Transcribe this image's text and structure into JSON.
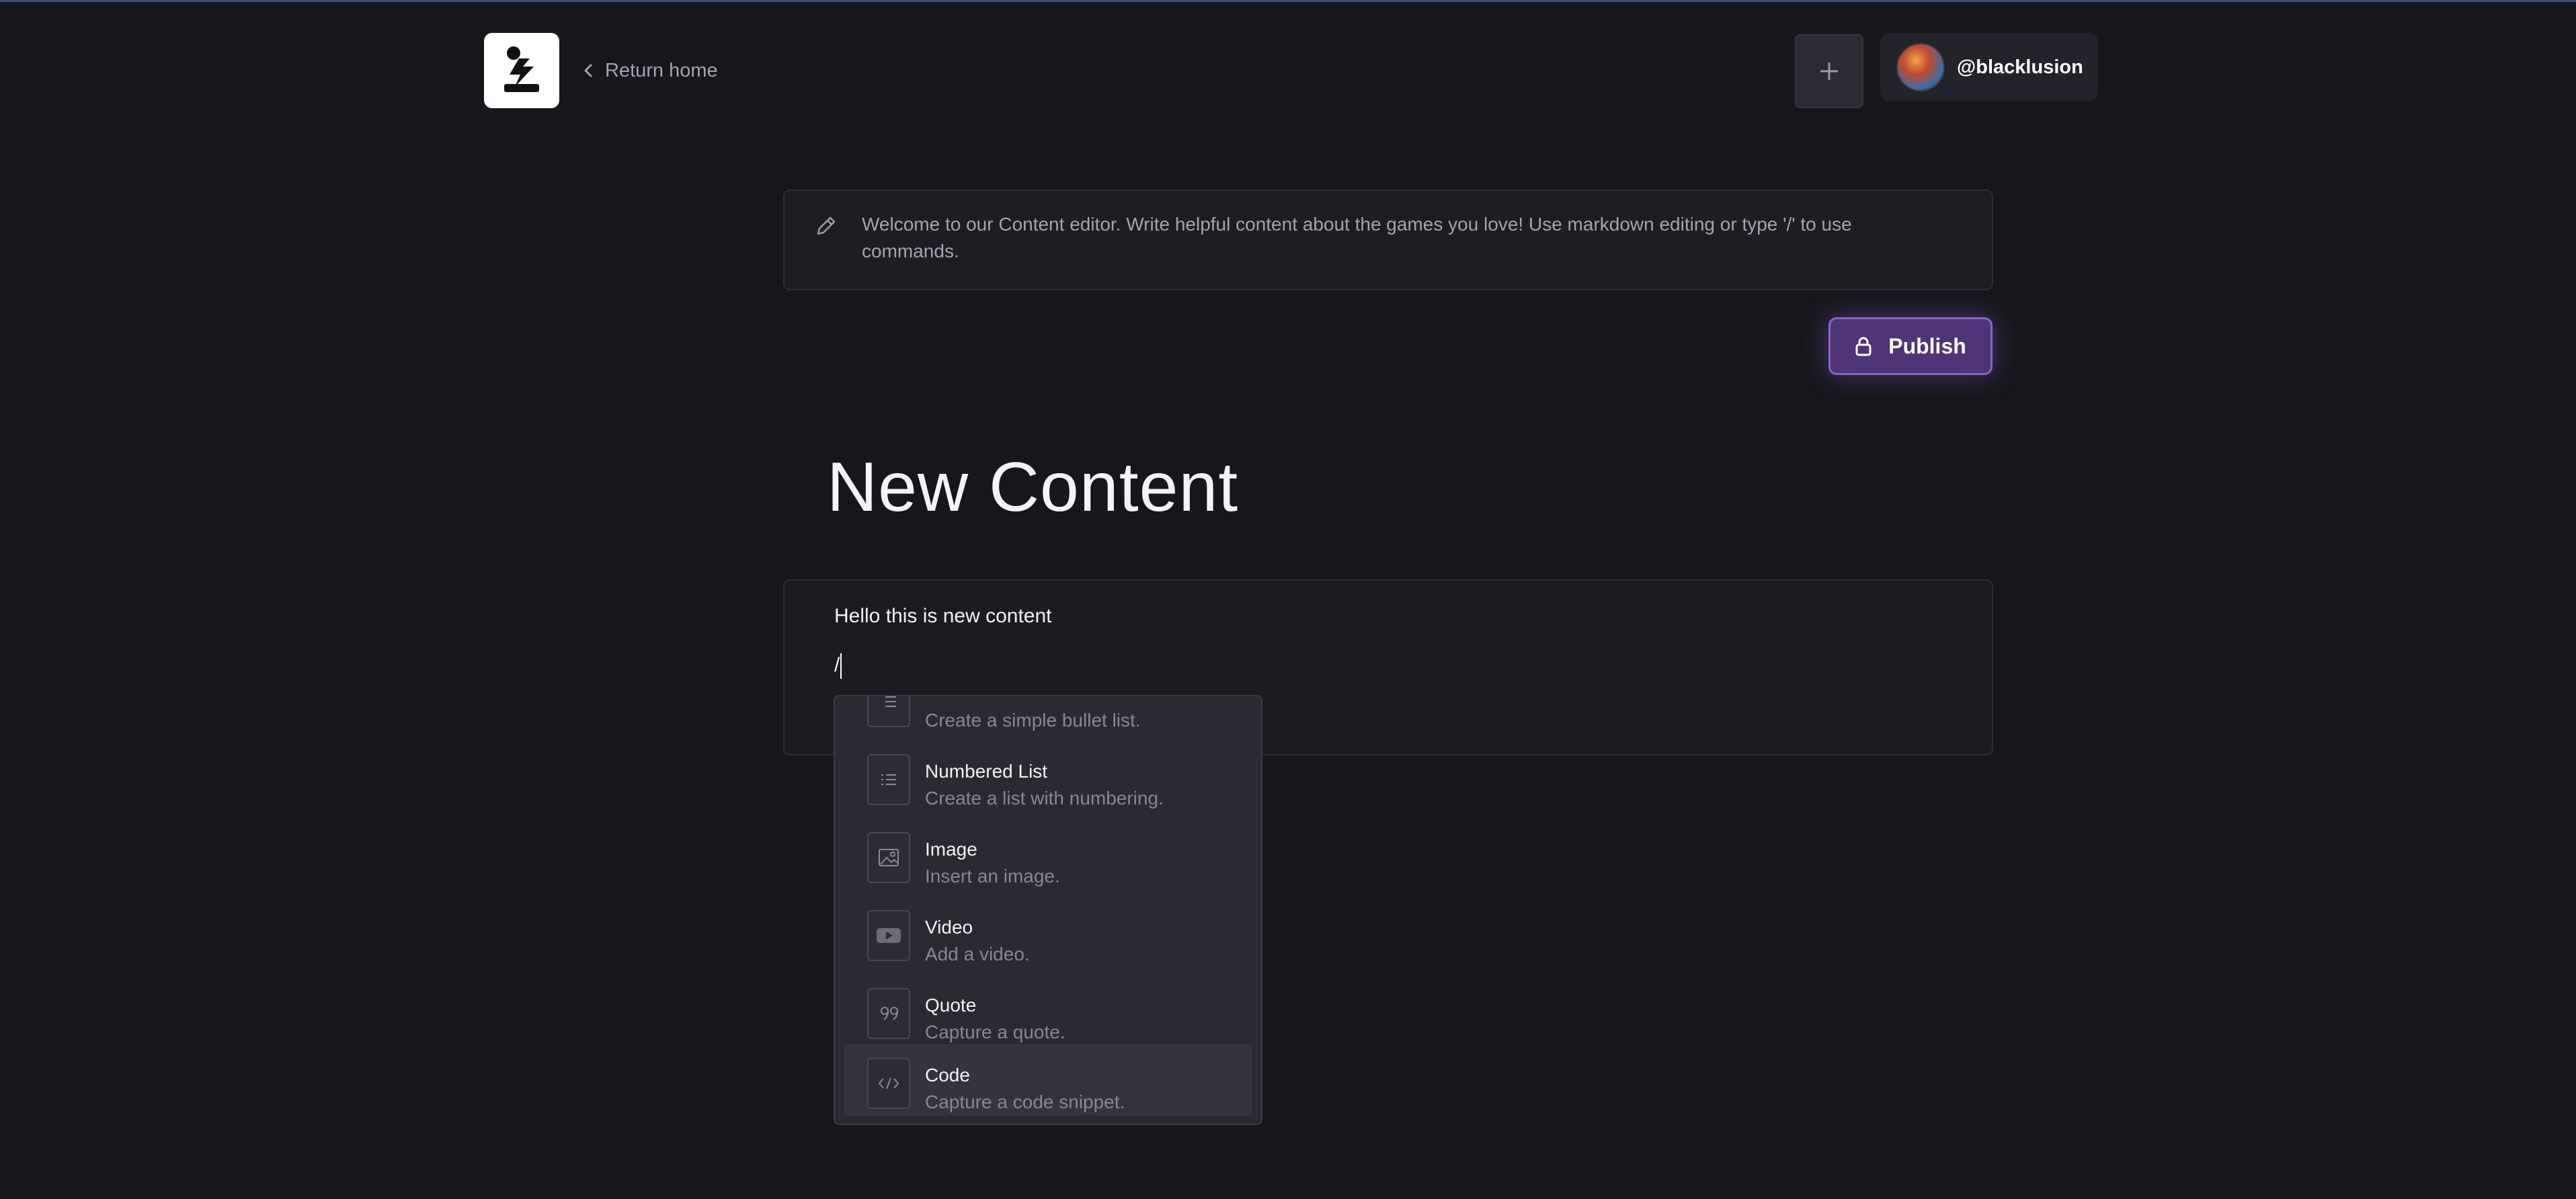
{
  "header": {
    "back_label": "Return home",
    "username": "@blacklusion"
  },
  "banner": {
    "text": "Welcome to our Content editor. Write helpful content about the games you love! Use markdown editing or type '/' to use commands."
  },
  "publish_label": "Publish",
  "page_title": "New Content",
  "editor": {
    "line1": "Hello this is new content",
    "line2": "/"
  },
  "slash_menu": {
    "items": [
      {
        "title": "",
        "desc": "Create a simple bullet list.",
        "icon": "bullet-list-icon"
      },
      {
        "title": "Numbered List",
        "desc": "Create a list with numbering.",
        "icon": "numbered-list-icon"
      },
      {
        "title": "Image",
        "desc": "Insert an image.",
        "icon": "image-icon"
      },
      {
        "title": "Video",
        "desc": "Add a video.",
        "icon": "video-icon"
      },
      {
        "title": "Quote",
        "desc": "Capture a quote.",
        "icon": "quote-icon"
      },
      {
        "title": "Code",
        "desc": "Capture a code snippet.",
        "icon": "code-icon",
        "active": true
      }
    ]
  },
  "colors": {
    "background": "#16171c",
    "accent": "#8d63c9",
    "publish_fill": "#4e3577"
  }
}
